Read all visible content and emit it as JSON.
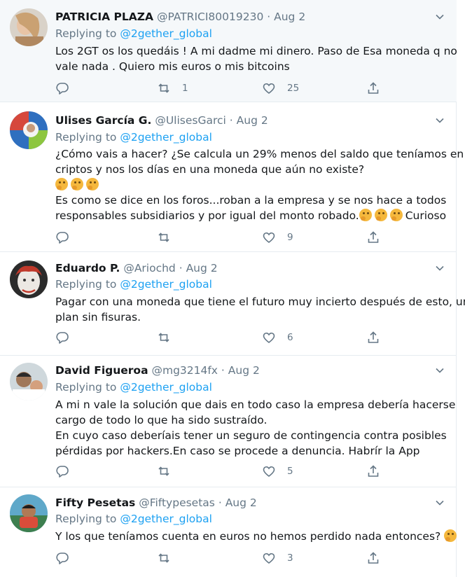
{
  "tweets": [
    {
      "name": "PATRICIA PLAZA",
      "handle": "@PATRICI80019230",
      "date": "Aug 2",
      "reply_prefix": "Replying to",
      "reply_to": "@2gether_global",
      "lines": [
        "Los 2GT os los quedáis ! A mi dadme mi dinero. Paso de Esa moneda q no",
        "vale nada . Quiero mis euros o mis bitcoins"
      ],
      "retweets": "1",
      "likes": "25"
    },
    {
      "name": "Ulises García G.",
      "handle": "@UlisesGarci",
      "date": "Aug 2",
      "reply_prefix": "Replying to",
      "reply_to": "@2gether_global",
      "lines": [
        "¿Cómo vais a hacer? ¿Se calcula un 29% menos del saldo que teníamos en",
        "criptos y nos los días en una moneda que aún no existe?"
      ],
      "lines2": [
        "Es como se dice en los foros...roban a la empresa y se nos hace a todos",
        "responsables subsidiarios y por igual del monto robado."
      ],
      "trailing": "Curioso",
      "retweets": "",
      "likes": "9"
    },
    {
      "name": "Eduardo P.",
      "handle": "@Ariochd",
      "date": "Aug 2",
      "reply_prefix": "Replying to",
      "reply_to": "@2gether_global",
      "lines": [
        "Pagar con una moneda que tiene el futuro muy incierto después de esto, un",
        "plan sin fisuras."
      ],
      "retweets": "",
      "likes": "6"
    },
    {
      "name": "David Figueroa",
      "handle": "@mg3214fx",
      "date": "Aug 2",
      "reply_prefix": "Replying to",
      "reply_to": "@2gether_global",
      "lines": [
        "A mi n vale la solución que dais en todo caso la empresa debería hacerse",
        "cargo de todo lo que ha sido sustraído.",
        "En cuyo caso deberíais tener un seguro de contingencia contra posibles",
        "pérdidas por hackers.En caso se procede a denuncia. Habrír la App"
      ],
      "retweets": "",
      "likes": "5"
    },
    {
      "name": "Fifty Pesetas",
      "handle": "@Fiftypesetas",
      "date": "Aug 2",
      "reply_prefix": "Replying to",
      "reply_to": "@2gether_global",
      "lines": [
        "Y los que teníamos cuenta en euros no hemos perdido nada entonces?"
      ],
      "retweets": "",
      "likes": "3"
    }
  ],
  "separator": "·",
  "icons": [
    "reply-icon",
    "retweet-icon",
    "like-icon",
    "share-icon",
    "chevron-down-icon",
    "thinking-face-emoji"
  ],
  "colors": {
    "link": "#1da1f2",
    "secondary": "#657786",
    "text": "#14171a",
    "border": "#e6ecf0",
    "highlight_bg": "#f5f8fa"
  }
}
